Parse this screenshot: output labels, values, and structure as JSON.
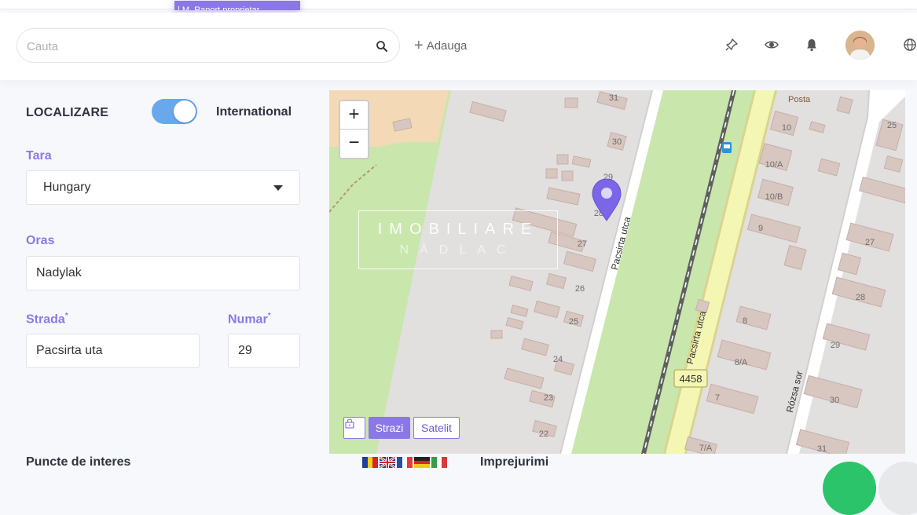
{
  "report_tab": {
    "label": "| M. Raport proprietar"
  },
  "header": {
    "search_placeholder": "Cauta",
    "add_label": "Adauga"
  },
  "location": {
    "title": "LOCALIZARE",
    "international_label": "International",
    "international_on": true,
    "country_label": "Tara",
    "country_value": "Hungary",
    "city_label": "Oras",
    "city_value": "Nadylak",
    "street_label": "Strada",
    "street_value": "Pacsirta uta",
    "number_label": "Numar",
    "number_value": "29",
    "required_mark": "*"
  },
  "map": {
    "zoom_in": "+",
    "zoom_out": "−",
    "watermark_line1": "IMOBILIARE",
    "watermark_line2": "NĂDLAC",
    "btn_streets": "Strazi",
    "btn_satellite": "Satelit",
    "active_layer": "Strazi",
    "labels": {
      "street1": "Pacsirta utca",
      "street2": "Pacsirta utca",
      "street3": "Rózsa sor",
      "posta": "Posta",
      "road_number": "4458",
      "house_numbers": [
        "31",
        "30",
        "29",
        "28",
        "27",
        "26",
        "25",
        "24",
        "23",
        "22",
        "10",
        "10/A",
        "10/B",
        "9",
        "8",
        "8/A",
        "7",
        "7/A",
        "25",
        "27",
        "28",
        "29",
        "30",
        "31"
      ]
    }
  },
  "bottom": {
    "poi_title": "Puncte de interes",
    "surroundings_title": "Imprejurimi"
  },
  "colors": {
    "accent": "#8b78e6",
    "toggle": "#6aa8ee",
    "map_road_yellow": "#f4f6b4",
    "map_green": "#c6e6aa",
    "pin": "#7b66e8"
  }
}
